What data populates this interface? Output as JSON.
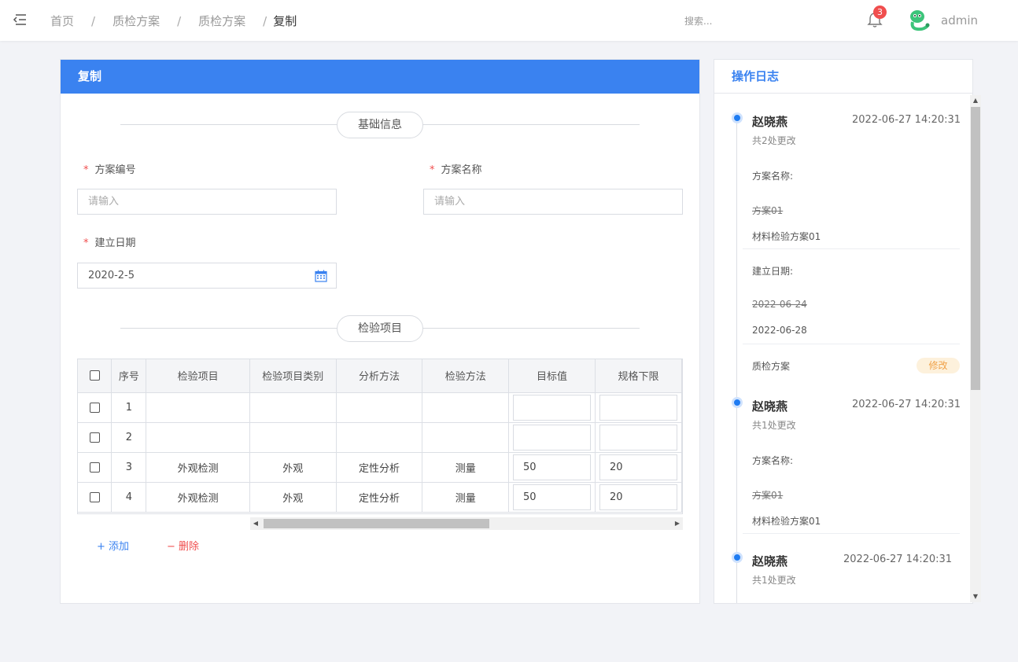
{
  "breadcrumb": {
    "items": [
      "首页",
      "质检方案",
      "质检方案",
      "复制"
    ],
    "sep": "/"
  },
  "search": {
    "placeholder": "搜索..."
  },
  "notifications": {
    "count": "3"
  },
  "user": {
    "name": "admin"
  },
  "card": {
    "title": "复制"
  },
  "sections": {
    "basic": "基础信息",
    "items": "检验项目"
  },
  "form": {
    "required_mark": "*",
    "code_label": "方案编号",
    "code_placeholder": "请输入",
    "name_label": "方案名称",
    "name_placeholder": "请输入",
    "date_label": "建立日期",
    "date_value": "2020-2-5"
  },
  "table": {
    "headers": [
      "序号",
      "检验项目",
      "检验项目类别",
      "分析方法",
      "检验方法",
      "目标值",
      "规格下限"
    ],
    "rows": [
      {
        "no": "1",
        "item": "",
        "category": "",
        "analysis": "",
        "method": "",
        "target": "",
        "lower": ""
      },
      {
        "no": "2",
        "item": "",
        "category": "",
        "analysis": "",
        "method": "",
        "target": "",
        "lower": ""
      },
      {
        "no": "3",
        "item": "外观检测",
        "category": "外观",
        "analysis": "定性分析",
        "method": "测量",
        "target": "50",
        "lower": "20"
      },
      {
        "no": "4",
        "item": "外观检测",
        "category": "外观",
        "analysis": "定性分析",
        "method": "测量",
        "target": "50",
        "lower": "20"
      }
    ]
  },
  "actions": {
    "add": "+ 添加",
    "delete": "− 删除"
  },
  "log": {
    "title": "操作日志",
    "entries": [
      {
        "user": "赵晓燕",
        "time": "2022-06-27 14:20:31",
        "count": "共2处更改",
        "field1": "方案名称:",
        "old1": "方案01",
        "new1": "材料检验方案01",
        "field2": "建立日期:",
        "old2": "2022-06-24",
        "new2": "2022-06-28",
        "scheme": "质检方案",
        "tag": "修改"
      },
      {
        "user": "赵晓燕",
        "time": "2022-06-27 14:20:31",
        "count": "共1处更改",
        "field1": "方案名称:",
        "old1": "方案01",
        "new1": "材料检验方案01"
      },
      {
        "user": "赵晓燕",
        "time": "2022-06-27 14:20:31",
        "count": "共1处更改"
      }
    ]
  },
  "colors": {
    "primary": "#3a82f0",
    "danger": "#f04e4e",
    "tag_bg": "#fdf1dc",
    "tag_text": "#f0a24a"
  }
}
